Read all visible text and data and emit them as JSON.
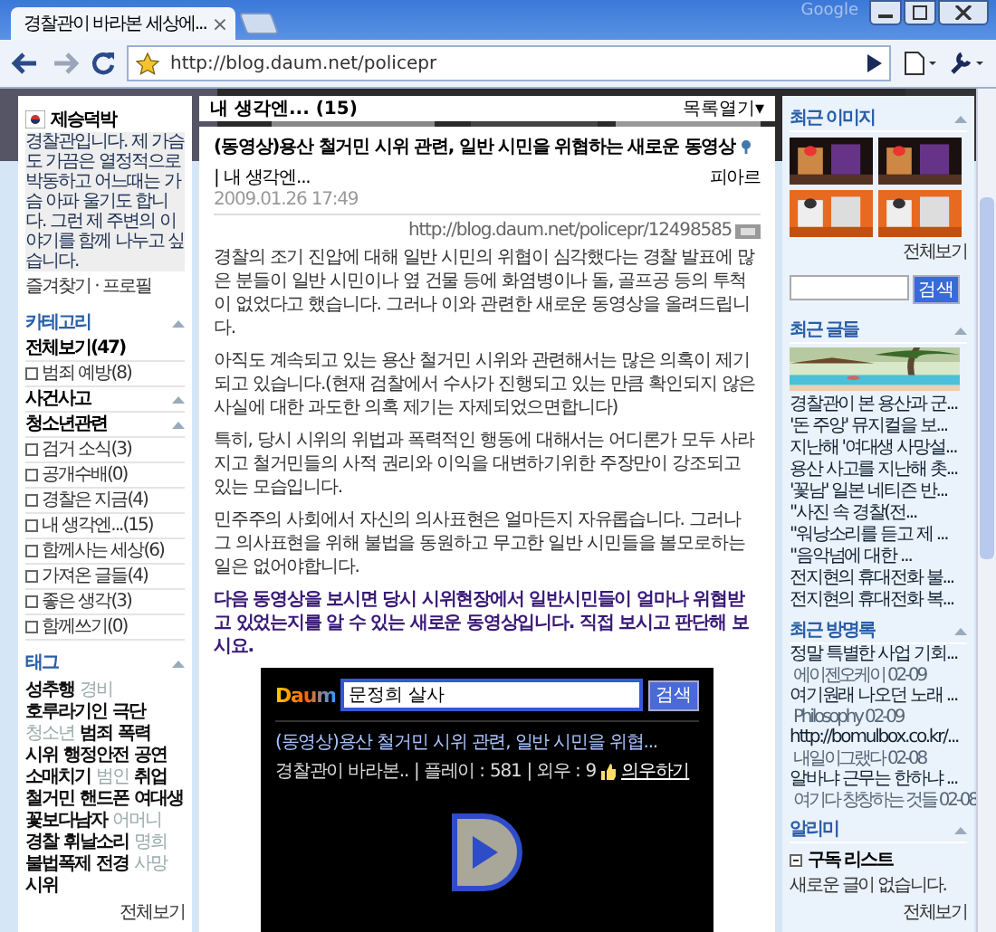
{
  "browser": {
    "tab": {
      "title": "경찰관이 바라본 세상에...",
      "close": "×"
    },
    "brand": "Google",
    "address": "http://blog.daum.net/policepr"
  },
  "profile": {
    "name": "제승덕박",
    "bio": "경찰관입니다. 제 가슴도 가끔은 열정적으로 박동하고 어느때는 가슴 아파 울기도 합니다. 그런 제 주변의 이야기를 함께 나누고 싶습니다.",
    "links": "즐겨찾기 · 프로필"
  },
  "categories": {
    "title": "카테고리",
    "items": [
      {
        "kind": "all",
        "label": "전체보기",
        "count": "(47)"
      },
      {
        "kind": "folder",
        "label": "범죄 예방",
        "count": "(8)"
      },
      {
        "kind": "group",
        "label": "사건사고"
      },
      {
        "kind": "group",
        "label": "청소년관련"
      },
      {
        "kind": "folder",
        "label": "검거 소식",
        "count": "(3)"
      },
      {
        "kind": "folder",
        "label": "공개수배",
        "count": "(0)"
      },
      {
        "kind": "folder",
        "label": "경찰은 지금",
        "count": "(4)"
      },
      {
        "kind": "folder",
        "label": "내 생각엔...",
        "count": "(15)"
      },
      {
        "kind": "folder",
        "label": "함께사는 세상",
        "count": "(6)"
      },
      {
        "kind": "folder",
        "label": "가져온 글들",
        "count": "(4)"
      },
      {
        "kind": "folder",
        "label": "좋은 생각",
        "count": "(3)"
      },
      {
        "kind": "folder",
        "label": "함께쓰기",
        "count": "(0)"
      }
    ]
  },
  "tags": {
    "title": "태그",
    "items": [
      {
        "text": "성추행",
        "faded": false
      },
      {
        "text": "경비",
        "faded": true
      },
      {
        "text": "호루라기인",
        "faded": false
      },
      {
        "text": "극단",
        "faded": false
      },
      {
        "text": "청소년",
        "faded": true
      },
      {
        "text": "범죄",
        "faded": false
      },
      {
        "text": "폭력",
        "faded": false
      },
      {
        "text": "시위",
        "faded": false
      },
      {
        "text": "행정안전",
        "faded": false
      },
      {
        "text": "공연",
        "faded": false
      },
      {
        "text": "소매치기",
        "faded": false
      },
      {
        "text": "범인",
        "faded": true
      },
      {
        "text": "취업",
        "faded": false
      },
      {
        "text": "철거민",
        "faded": false
      },
      {
        "text": "핸드폰",
        "faded": false
      },
      {
        "text": "여대생",
        "faded": false
      },
      {
        "text": "꽃보다남자",
        "faded": false
      },
      {
        "text": "어머니",
        "faded": true
      },
      {
        "text": "경찰",
        "faded": false
      },
      {
        "text": "휘날소리",
        "faded": false
      },
      {
        "text": "명희",
        "faded": true
      },
      {
        "text": "불법폭제",
        "faded": false
      },
      {
        "text": "전경",
        "faded": false
      },
      {
        "text": "사망",
        "faded": true
      },
      {
        "text": "시위",
        "faded": false
      }
    ],
    "more": "전체보기"
  },
  "post": {
    "category": "내 생각엔... (15)",
    "list_toggle": "목록열기▾",
    "title": "(동영상)용산 철거민 시위 관련, 일반 시민을 위협하는 새로운 동영상",
    "title_category": "| 내 생각엔...",
    "author": "피아르",
    "date": "2009.01.26 17:49",
    "url": "http://blog.daum.net/policepr/12498585",
    "paragraphs": [
      {
        "kind": "normal",
        "text": "경찰의 조기 진압에 대해 일반 시민의 위협이 심각했다는 경찰 발표에 많은 분들이 일반 시민이나 옆 건물 등에 화염병이나 돌, 골프공 등의 투척이 없었다고 했습니다. 그러나 이와 관련한 새로운 동영상을 올려드립니다."
      },
      {
        "kind": "normal",
        "text": "아직도 계속되고 있는 용산 철거민 시위와 관련해서는 많은 의혹이 제기되고 있습니다.(현재 검찰에서 수사가 진행되고 있는 만큼 확인되지 않은 사실에 대한 과도한 의혹 제기는 자제되었으면합니다)"
      },
      {
        "kind": "normal",
        "text": "특히, 당시 시위의 위법과 폭력적인 행동에 대해서는 어디론가 모두 사라지고 철거민들의 사적 권리와 이익을 대변하기위한 주장만이 강조되고 있는 모습입니다."
      },
      {
        "kind": "normal",
        "text": "민주주의 사회에서 자신의 의사표현은 얼마든지 자유롭습니다. 그러나 그 의사표현을 위해 불법을 동원하고 무고한 일반 시민들을 볼모로하는 일은 없어야합니다."
      },
      {
        "kind": "emphasis",
        "text": "다음 동영상을 보시면 당시 시위현장에서 일반시민들이 얼마나 위협받고 있었는지를 알 수 있는 새로운 동영상입니다. 직접 보시고 판단해 보시요."
      }
    ]
  },
  "video": {
    "logo": "Daum",
    "search_value": "문정희 살사",
    "search_button": "검색",
    "title": "(동영상)용산 철거민 시위 관련, 일반 시민을 위협...",
    "meta": [
      "경찰관이 바라본..",
      "| 플레이 :",
      "581",
      "| 외우 :",
      "9"
    ],
    "recommend": "의우하기"
  },
  "recent_images": {
    "title": "최근 이미지",
    "more": "전체보기"
  },
  "search": {
    "button": "검색"
  },
  "recent_posts": {
    "title": "최근 글들",
    "items": [
      "경찰관이 본 용산과 군...",
      "'돈 주앙' 뮤지컬을 보...",
      "지난해 '여대생 사망설...",
      "용산 사고를 지난해 촛...",
      "'꽃남' 일본 네티즌 반...",
      "\"사진 속 경찰(전...",
      "\"워낭소리를 듣고 제 ...",
      "\"음악넘에 대한 ...",
      "전지현의 휴대전화 불...",
      "전지현의 휴대전화 복..."
    ]
  },
  "guestbook": {
    "title": "최근 방명록",
    "items": [
      {
        "text": "정말 특별한 사업 기회...",
        "meta": "에이젠오케이 02-09"
      },
      {
        "text": "여기원래 나오던 노래 ...",
        "meta": "Philosophy 02-09"
      },
      {
        "text": "http://bomulbox.co.kr/...",
        "meta": "내일이그랬다 02-08"
      },
      {
        "text": "알바냐 근무는 한하냐 ...",
        "meta": "여기다 창창하는 것들 02-08"
      }
    ]
  },
  "notifier": {
    "title": "알리미",
    "list_title": "구독 리스트",
    "empty": "새로운 글이 없습니다.",
    "more": "전체보기"
  }
}
